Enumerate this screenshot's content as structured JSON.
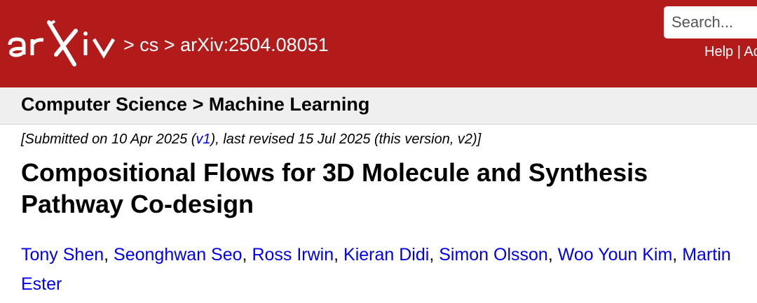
{
  "header": {
    "logo_text": "arXiv",
    "breadcrumb": {
      "sep1": " > ",
      "category": "cs",
      "sep2": " > ",
      "paper_id": "arXiv:2504.08051"
    },
    "search": {
      "placeholder": "Search..."
    },
    "help": {
      "help_label": "Help",
      "sep": " | ",
      "advanced_label": "Ad"
    }
  },
  "subheader": {
    "title": "Computer Science > Machine Learning"
  },
  "dateline": {
    "prefix": "[Submitted on 10 Apr 2025 (",
    "v1_link": "v1",
    "suffix": "), last revised 15 Jul 2025 (this version, v2)]"
  },
  "paper": {
    "title": "Compositional Flows for 3D Molecule and Synthesis Pathway Co-design",
    "authors": [
      "Tony Shen",
      "Seonghwan Seo",
      "Ross Irwin",
      "Kieran Didi",
      "Simon Olsson",
      "Woo Youn Kim",
      "Martin Ester"
    ],
    "author_separator": ", "
  },
  "colors": {
    "brand_red": "#b31b1b",
    "link_blue": "#0000ee",
    "subheader_gray": "#efefef"
  }
}
